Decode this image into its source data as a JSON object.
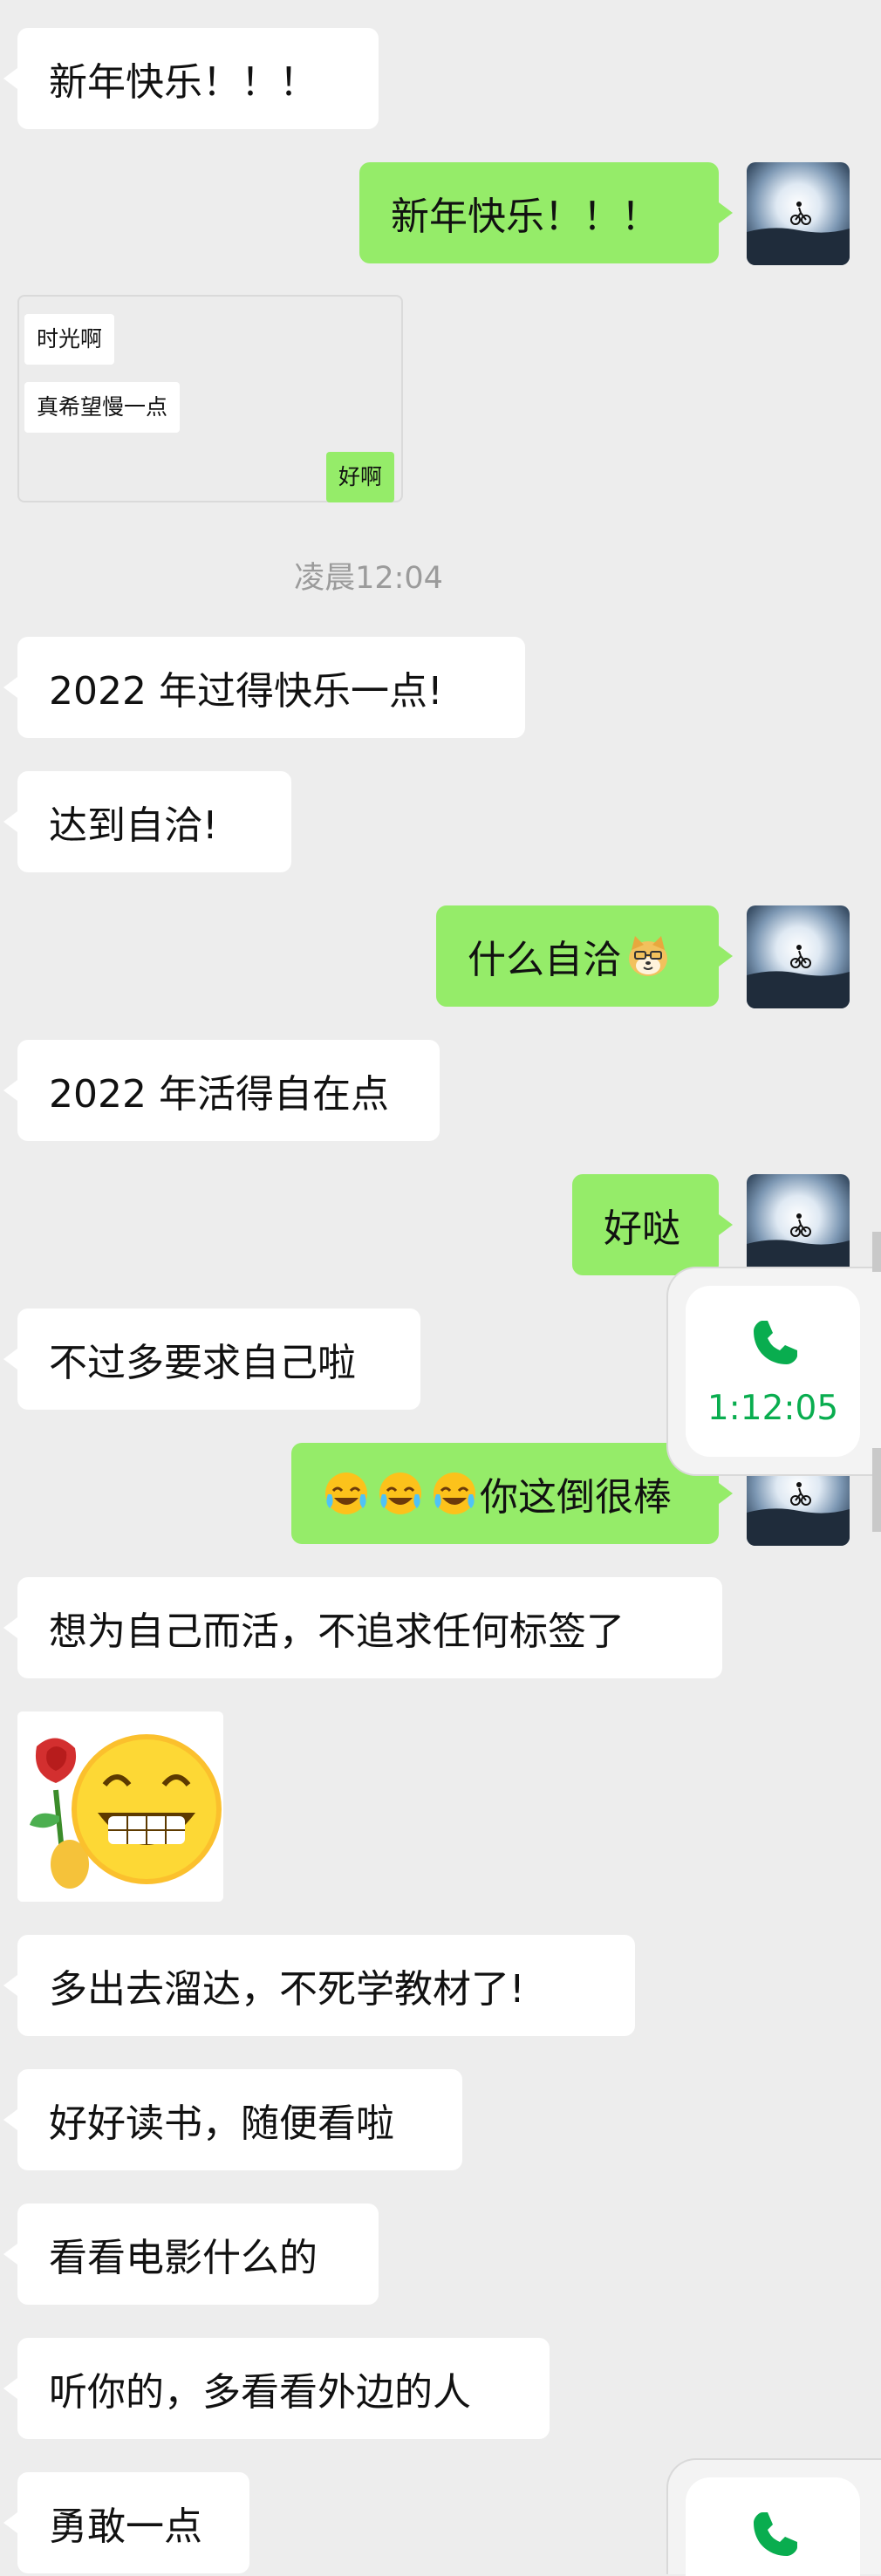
{
  "messages": [
    {
      "side": "in",
      "text": "新年快乐！！！"
    },
    {
      "side": "out",
      "text": "新年快乐！！！"
    },
    {
      "side": "in",
      "text": "2022 年过得快乐一点!"
    },
    {
      "side": "in",
      "text": "达到自洽!"
    },
    {
      "side": "out",
      "text": "什么自洽",
      "emoji": "doge-emoji"
    },
    {
      "side": "in",
      "text": "2022 年活得自在点"
    },
    {
      "side": "out",
      "text": "好哒"
    },
    {
      "side": "in",
      "text": "不过多要求自己啦"
    },
    {
      "side": "out",
      "text": "你这倒很棒",
      "emoji": "laugh-cry-emoji x3"
    },
    {
      "side": "in",
      "text": "想为自己而活，不追求任何标签了"
    },
    {
      "side": "in",
      "text": "多出去溜达，不死学教材了!"
    },
    {
      "side": "in",
      "text": "好好读书，随便看啦"
    },
    {
      "side": "in",
      "text": "看看电影什么的"
    },
    {
      "side": "in",
      "text": "听你的，多看看外边的人"
    },
    {
      "side": "in",
      "text": "勇敢一点"
    }
  ],
  "timestamp": "凌晨12:04",
  "quote_card": {
    "bubbles": [
      "时光啊",
      "真希望慢一点",
      "好啊"
    ]
  },
  "call_widget": {
    "duration": "1:12:05",
    "icon": "phone-icon"
  },
  "sticker": {
    "name": "rose-grin-sticker"
  },
  "colors": {
    "background": "#ededed",
    "bubble_out": "#95ec69",
    "bubble_in": "#ffffff",
    "call_green": "#09ad4f"
  }
}
